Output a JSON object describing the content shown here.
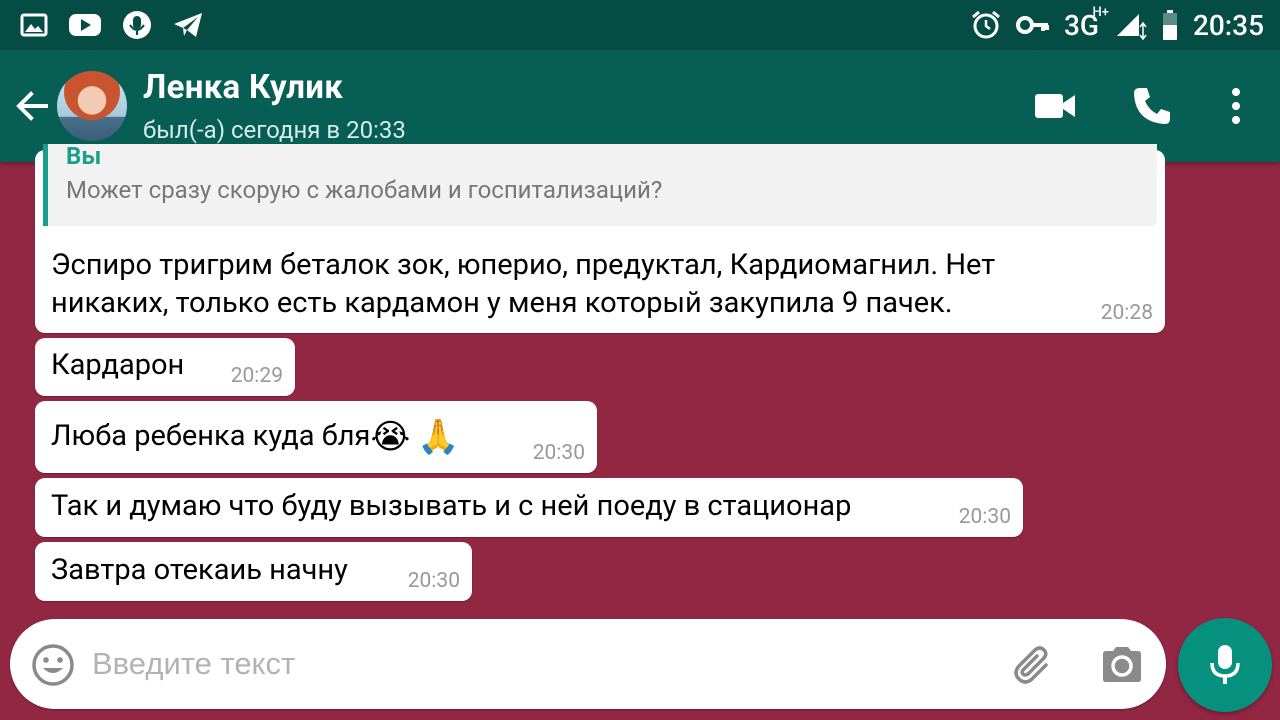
{
  "status_bar": {
    "time": "20:35",
    "network": "3G",
    "network_sup": "H+",
    "left_icons": [
      "gallery-icon",
      "youtube-icon",
      "microphone-icon",
      "telegram-icon"
    ],
    "right_icons": [
      "alarm-icon",
      "key-icon",
      "signal-icon",
      "battery-icon"
    ]
  },
  "header": {
    "contact_name": "Ленка Кулик",
    "last_seen": "был(-а) сегодня в 20:33",
    "bg_color": "#075e54"
  },
  "messages": [
    {
      "quote_author": "Вы",
      "quote_text": "Может сразу скорую с жалобами и госпитализаций?",
      "lines": [
        "Эспиро тригрим беталок зок, юперио, предуктал, Кардиомагнил. Нет",
        "никаких, только есть кардамон у меня который закупила 9 пачек."
      ],
      "time": "20:28"
    },
    {
      "text": "Кардарон",
      "time": "20:29"
    },
    {
      "text": "Люба ребенка куда бля",
      "emojis": [
        "😭",
        "🙏"
      ],
      "time": "20:30"
    },
    {
      "text": "Так и думаю что буду вызывать и с ней поеду в стационар",
      "time": "20:30"
    },
    {
      "text": "Завтра отекаиь начну",
      "time": "20:30"
    }
  ],
  "input": {
    "placeholder": "Введите текст"
  },
  "colors": {
    "chat_background": "#922744",
    "accent": "#06907e",
    "status_bar": "#054d44"
  }
}
